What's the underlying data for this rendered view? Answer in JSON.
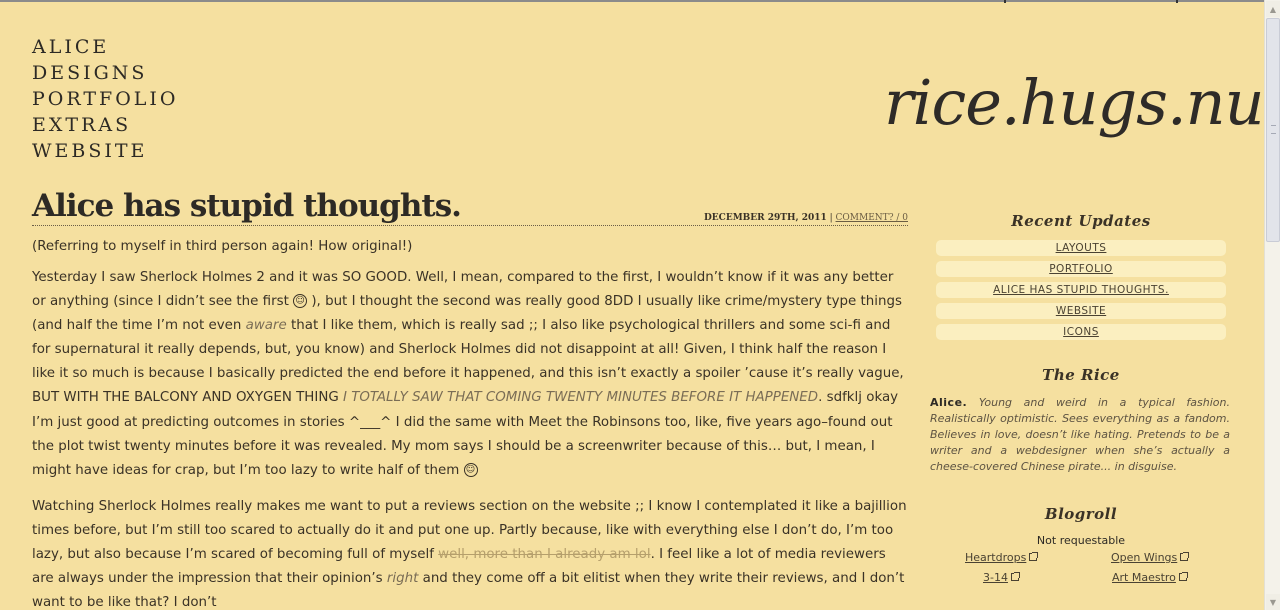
{
  "nav": [
    "ALICE",
    "DESIGNS",
    "PORTFOLIO",
    "EXTRAS",
    "WEBSITE"
  ],
  "logo": "rice.hugs.nu",
  "post": {
    "title": "Alice has stupid thoughts.",
    "date": "DECEMBER 29TH, 2011",
    "separator": " | ",
    "comments": "COMMENT? / 0",
    "p1": "(Referring to myself in third person again! How original!)",
    "p2_a": "Yesterday I saw Sherlock Holmes 2 and it was SO GOOD. Well, I mean, compared to the first, I wouldn’t know if it was any better or anything (since I didn’t see the first ",
    "p2_b": " ), but I thought the second was really good 8DD I usually like crime/mystery type things (and half the time I’m not even ",
    "p2_em1": "aware",
    "p2_c": " that I like them, which is really sad ;; I also like psychological thrillers and some sci-fi and for supernatural it really depends, but, you know) and Sherlock Holmes did not disappoint at all! Given, I think half the reason I like it so much is because I basically predicted the end before it happened, and this isn’t exactly a spoiler ’cause it’s really vague, BUT WITH THE BALCONY AND OXYGEN THING ",
    "p2_em2": "I TOTALLY SAW THAT COMING TWENTY MINUTES BEFORE IT HAPPENED",
    "p2_d": ". sdfklj okay I’m just good at predicting outcomes in stories ^___^ I did the same with Meet the Robinsons too, like, five years ago–found out the plot twist twenty minutes before it was revealed. My mom says I should be a screenwriter because of this… but, I mean, I might have ideas for crap, but I’m too lazy to write half of them ",
    "p3_a": "Watching Sherlock Holmes really makes me want to put a reviews section on the website ;; I know I contemplated it like a bajillion times before, but I’m still too scared to actually do it and put one up. Partly because, like with everything else I don’t do, I’m too lazy, but also because I’m scared of becoming full of myself ",
    "p3_strike": "well, more than I already am lol",
    "p3_b": ". I feel like a lot of media reviewers are always under the impression that their opinion’s ",
    "p3_em": "right",
    "p3_c": " and they come off a bit elitist when they write their reviews, and I don’t want to be like that? I don’t"
  },
  "sidebar": {
    "recent_title": "Recent Updates",
    "recent": [
      "LAYOUTS",
      "PORTFOLIO",
      "ALICE HAS STUPID THOUGHTS.",
      "WEBSITE",
      "ICONS"
    ],
    "rice_title": "The Rice",
    "bio_name": "Alice.",
    "bio_text": " Young and weird in a typical fashion. Realistically optimistic. Sees everything as a fandom. Believes in love, doesn’t like hating. Pretends to be a writer and a webdesigner when she’s actually a cheese-covered Chinese pirate... in disguise.",
    "blogroll_title": "Blogroll",
    "not_requestable": "Not requestable",
    "links": [
      "Heartdrops",
      "Open Wings",
      "3-14",
      "Art Maestro"
    ]
  },
  "icons": [
    "smiley-icon",
    "external-link-icon",
    "scroll-up-arrow",
    "scroll-down-arrow"
  ]
}
